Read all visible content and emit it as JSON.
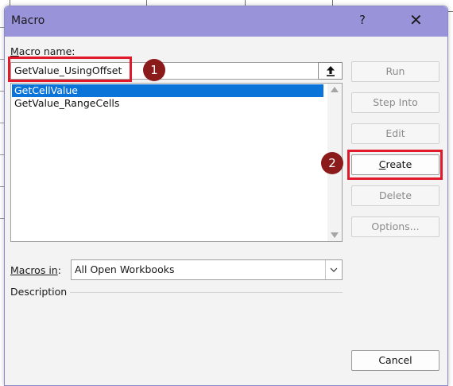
{
  "dialog": {
    "title": "Macro",
    "help_glyph": "?",
    "close_glyph": "✕"
  },
  "macro_name": {
    "label_first": "M",
    "label_rest": "acro name:",
    "value": "GetValue_UsingOffset"
  },
  "macro_list": {
    "items": [
      "GetCellValue",
      "GetValue_RangeCells"
    ],
    "selected_index": 0
  },
  "macros_in": {
    "label_first": "Macros in",
    "label_rest": ":",
    "selected": "All Open Workbooks"
  },
  "description": {
    "label": "Description"
  },
  "buttons": {
    "run": "Run",
    "step_into": "Step Into",
    "edit": "Edit",
    "create_first": "C",
    "create_rest": "reate",
    "delete": "Delete",
    "options": "Options...",
    "cancel": "Cancel"
  },
  "annotations": {
    "badge_1": "1",
    "badge_2": "2",
    "highlight_color": "#e2192a",
    "badge_color": "#8b1a1a"
  },
  "colors": {
    "titlebar": "#9993da",
    "selection": "#0a74d8",
    "dialog_bg": "#f3f3f3"
  },
  "icons": {
    "upload": "arrow-up-to-line-icon",
    "select_arrow": "chevron-down-icon"
  }
}
